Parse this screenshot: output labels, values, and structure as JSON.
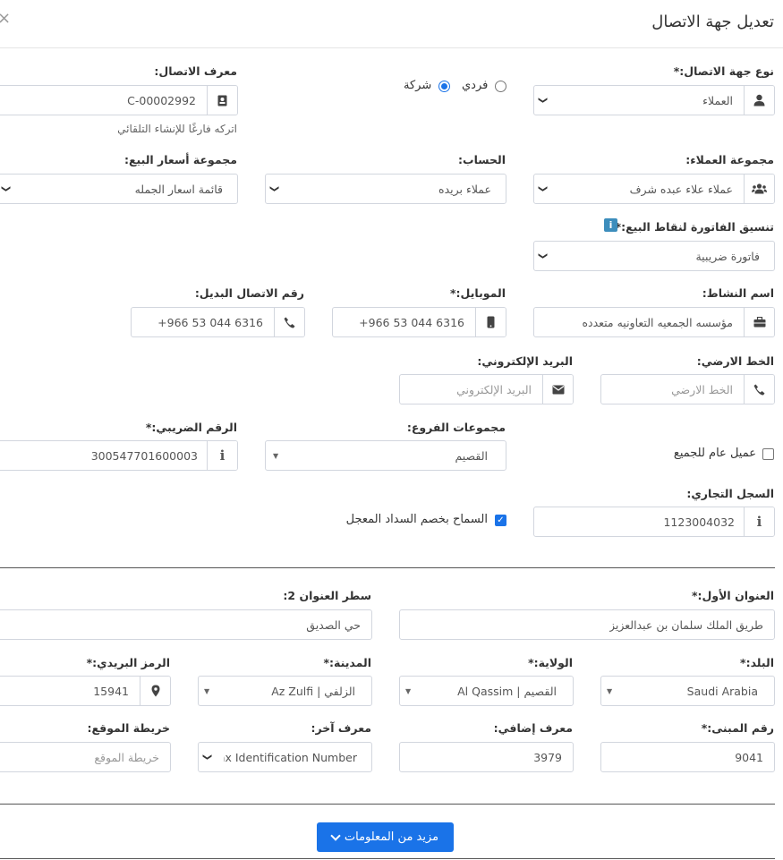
{
  "modal": {
    "title": "تعديل جهة الاتصال",
    "close": "×"
  },
  "contact_type": {
    "label": "نوع جهة الاتصال:*",
    "value": "العملاء",
    "radio_individual": "فردي",
    "radio_company": "شركة",
    "selected": "company"
  },
  "contact_id": {
    "label": "معرف الاتصال:",
    "value": "C-00002992",
    "help": "اتركه فارغًا للإنشاء التلقائي"
  },
  "customer_group": {
    "label": "مجموعة العملاء:",
    "value": "عملاء علاء عبده شرف"
  },
  "account": {
    "label": "الحساب:",
    "value": "عملاء بريده"
  },
  "price_group": {
    "label": "مجموعة أسعار البيع:",
    "value": "قائمة اسعار الجمله"
  },
  "invoice_layout": {
    "label": "تنسيق الفاتورة لنقاط البيع:*",
    "value": "فاتورة ضريبية",
    "info": "i"
  },
  "business_name": {
    "label": "اسم النشاط:",
    "value": "مؤسسه الجمعيه التعاونيه متعدده"
  },
  "mobile": {
    "label": "الموبايل:*",
    "value": "+966 53 044 6316"
  },
  "alt_number": {
    "label": "رقم الاتصال البديل:",
    "value": "+966 53 044 6316"
  },
  "landline": {
    "label": "الخط الارضي:",
    "placeholder": "الخط الارضي"
  },
  "email": {
    "label": "البريد الإلكتروني:",
    "placeholder": "البريد الإلكتروني"
  },
  "walk_in": {
    "label": "عميل عام للجميع",
    "checked": false
  },
  "branch_groups": {
    "label": "مجموعات الفروع:",
    "value": "القصيم"
  },
  "tax_number": {
    "label": "الرقم الضريبي:*",
    "value": "300547701600003"
  },
  "cr_number": {
    "label": "السجل التجاري:",
    "value": "1123004032"
  },
  "early_payment": {
    "label": "السماح بخصم السداد المعجل",
    "checked": true
  },
  "address1": {
    "label": "العنوان الأول:*",
    "value": "طريق الملك سلمان بن عبدالعزيز"
  },
  "address2": {
    "label": "سطر العنوان 2:",
    "value": "حي الصديق"
  },
  "country": {
    "label": "البلد:*",
    "value": "Saudi Arabia"
  },
  "state": {
    "label": "الولاية:*",
    "value": "Al Qassim | القصيم"
  },
  "city": {
    "label": "المدينة:*",
    "value": "Az Zulfi | الزلفي"
  },
  "zip": {
    "label": "الرمز البريدي:*",
    "value": "15941"
  },
  "building_no": {
    "label": "رقم المبنى:*",
    "value": "9041"
  },
  "additional_id": {
    "label": "معرف إضافي:",
    "value": "3979"
  },
  "other_id": {
    "label": "معرف آخر:",
    "value": "Tax Identification Number"
  },
  "map": {
    "label": "خريطة الموقع:",
    "placeholder": "خريطة الموقع"
  },
  "more_button": {
    "label": "مزيد من المعلومات"
  },
  "colors": {
    "primary": "#1a73e8",
    "border": "#d2d6de"
  }
}
